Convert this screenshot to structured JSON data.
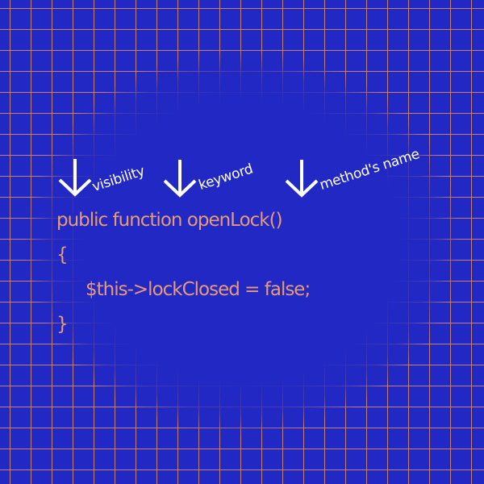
{
  "annotations": [
    {
      "icon": "down-arrow-icon",
      "label": "visibility"
    },
    {
      "icon": "down-arrow-icon",
      "label": "keyword"
    },
    {
      "icon": "down-arrow-icon",
      "label": "method's name"
    }
  ],
  "code": {
    "signature": "public function openLock()",
    "open_brace": "{",
    "body": "$this->lockClosed = false;",
    "close_brace": "}"
  },
  "colors": {
    "background": "#2128c4",
    "grid": "#e28c64",
    "code_text": "#e79a76",
    "annotation_text": "#ffffff"
  }
}
